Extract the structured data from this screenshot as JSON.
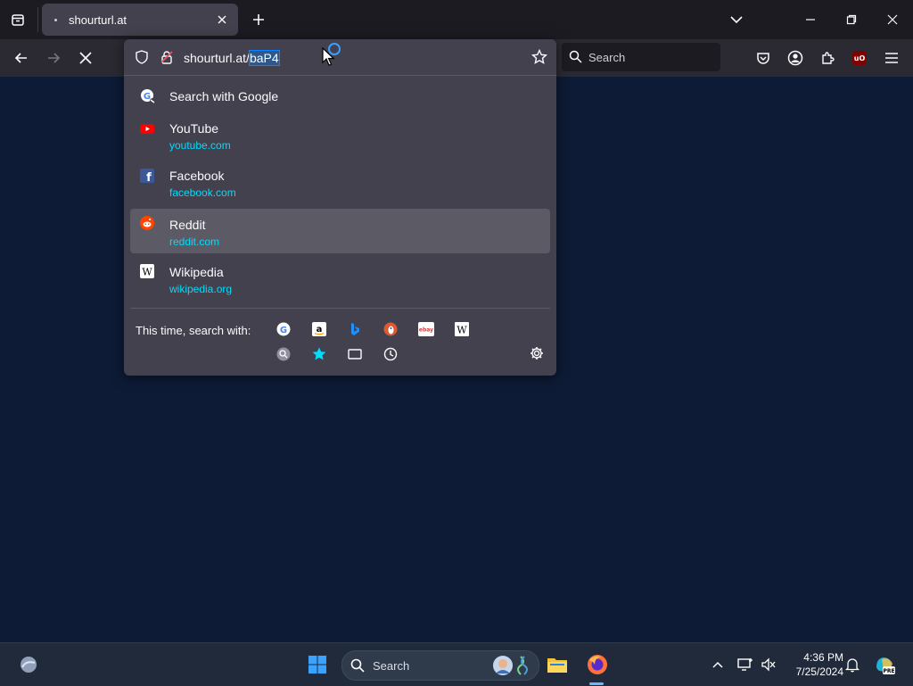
{
  "tab": {
    "title": "shourturl.at"
  },
  "urlbar": {
    "url_base": "shourturl.at/",
    "url_selected": "baP4"
  },
  "toolbar_search": {
    "placeholder": "Search"
  },
  "ublock_badge": "uO",
  "results": [
    {
      "name": "Search with Google",
      "icon": "google-search-icon"
    },
    {
      "name": "YouTube",
      "url": "youtube.com",
      "icon": "youtube-icon"
    },
    {
      "name": "Facebook",
      "url": "facebook.com",
      "icon": "facebook-icon"
    },
    {
      "name": "Reddit",
      "url": "reddit.com",
      "icon": "reddit-icon"
    },
    {
      "name": "Wikipedia",
      "url": "wikipedia.org",
      "icon": "wikipedia-icon"
    }
  ],
  "one_off": {
    "label": "This time, search with:",
    "engines": [
      "google",
      "amazon",
      "bing",
      "duckduckgo",
      "ebay",
      "wikipedia"
    ],
    "modes": [
      "search-engines",
      "bookmarks",
      "tabs",
      "history"
    ],
    "ebay_text": "ebay",
    "wiki_text": "W"
  },
  "taskbar": {
    "search_placeholder": "Search",
    "time": "4:36 PM",
    "date": "7/25/2024"
  },
  "colors": {
    "accent": "#00ddff",
    "page_bg": "#0d1b36",
    "panel_bg": "#42414d"
  }
}
